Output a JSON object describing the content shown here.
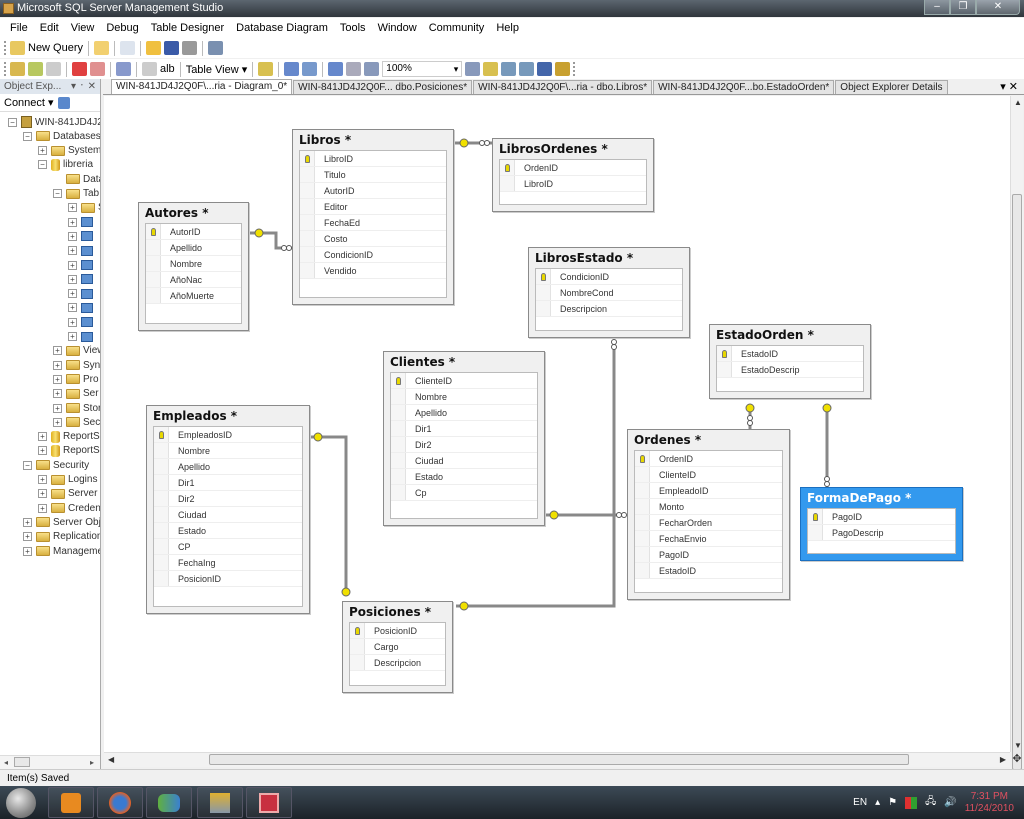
{
  "window": {
    "title": "Microsoft SQL Server Management Studio",
    "minimize": "–",
    "restore": "❐",
    "close": "✕"
  },
  "menu": [
    "File",
    "Edit",
    "View",
    "Debug",
    "Table Designer",
    "Database Diagram",
    "Tools",
    "Window",
    "Community",
    "Help"
  ],
  "toolbar1": {
    "new_query": "New Query"
  },
  "toolbar2": {
    "table_view": "Table View ▾",
    "zoom": "100%",
    "ab_label": "alb"
  },
  "object_explorer": {
    "title": "Object Exp...",
    "pin": "▾ ᛫ ✕",
    "connect": "Connect ▾",
    "nodes": [
      {
        "label": "WIN-841JD4J2",
        "level": 0,
        "expand": "−",
        "icon": "server"
      },
      {
        "label": "Databases",
        "level": 1,
        "expand": "−",
        "icon": "folder"
      },
      {
        "label": "System",
        "level": 2,
        "expand": "+",
        "icon": "folder"
      },
      {
        "label": "libreria",
        "level": 2,
        "expand": "−",
        "icon": "database"
      },
      {
        "label": "Data",
        "level": 3,
        "expand": "",
        "icon": "folder"
      },
      {
        "label": "Tab",
        "level": 3,
        "expand": "−",
        "icon": "folder"
      },
      {
        "label": "S",
        "level": 4,
        "expand": "+",
        "icon": "folder"
      },
      {
        "label": "",
        "level": 4,
        "expand": "+",
        "icon": "table"
      },
      {
        "label": "",
        "level": 4,
        "expand": "+",
        "icon": "table"
      },
      {
        "label": "",
        "level": 4,
        "expand": "+",
        "icon": "table"
      },
      {
        "label": "",
        "level": 4,
        "expand": "+",
        "icon": "table"
      },
      {
        "label": "",
        "level": 4,
        "expand": "+",
        "icon": "table"
      },
      {
        "label": "",
        "level": 4,
        "expand": "+",
        "icon": "table"
      },
      {
        "label": "",
        "level": 4,
        "expand": "+",
        "icon": "table"
      },
      {
        "label": "",
        "level": 4,
        "expand": "+",
        "icon": "table"
      },
      {
        "label": "",
        "level": 4,
        "expand": "+",
        "icon": "table"
      },
      {
        "label": "View",
        "level": 3,
        "expand": "+",
        "icon": "folder"
      },
      {
        "label": "Syn",
        "level": 3,
        "expand": "+",
        "icon": "folder"
      },
      {
        "label": "Pro",
        "level": 3,
        "expand": "+",
        "icon": "folder"
      },
      {
        "label": "Ser",
        "level": 3,
        "expand": "+",
        "icon": "folder"
      },
      {
        "label": "Stor",
        "level": 3,
        "expand": "+",
        "icon": "folder"
      },
      {
        "label": "Sec",
        "level": 3,
        "expand": "+",
        "icon": "folder"
      },
      {
        "label": "ReportS",
        "level": 2,
        "expand": "+",
        "icon": "database"
      },
      {
        "label": "ReportS",
        "level": 2,
        "expand": "+",
        "icon": "database"
      },
      {
        "label": "Security",
        "level": 1,
        "expand": "−",
        "icon": "folder"
      },
      {
        "label": "Logins",
        "level": 2,
        "expand": "+",
        "icon": "folder"
      },
      {
        "label": "Server I",
        "level": 2,
        "expand": "+",
        "icon": "folder"
      },
      {
        "label": "Creden",
        "level": 2,
        "expand": "+",
        "icon": "folder"
      },
      {
        "label": "Server Obj",
        "level": 1,
        "expand": "+",
        "icon": "folder"
      },
      {
        "label": "Replication",
        "level": 1,
        "expand": "+",
        "icon": "folder"
      },
      {
        "label": "Manageme",
        "level": 1,
        "expand": "+",
        "icon": "folder"
      }
    ]
  },
  "tabs": [
    {
      "label": "WIN-841JD4J2Q0F\\...ria - Diagram_0*",
      "active": true
    },
    {
      "label": "WIN-841JD4J2Q0F... dbo.Posiciones*",
      "active": false
    },
    {
      "label": "WIN-841JD4J2Q0F\\...ria - dbo.Libros*",
      "active": false
    },
    {
      "label": "WIN-841JD4J2Q0F...bo.EstadoOrden*",
      "active": false
    },
    {
      "label": "Object Explorer Details",
      "active": false
    }
  ],
  "tab_controls": "▾ ✕",
  "diagram": {
    "tables": [
      {
        "name": "Libros *",
        "columns": [
          "LibroID",
          "Titulo",
          "AutorID",
          "Editor",
          "FechaEd",
          "Costo",
          "CondicionID",
          "Vendido"
        ],
        "pk": [
          0
        ]
      },
      {
        "name": "LibrosOrdenes *",
        "columns": [
          "OrdenID",
          "LibroID"
        ],
        "pk": [
          0
        ]
      },
      {
        "name": "Autores *",
        "columns": [
          "AutorID",
          "Apellido",
          "Nombre",
          "AñoNac",
          "AñoMuerte"
        ],
        "pk": [
          0
        ]
      },
      {
        "name": "LibrosEstado *",
        "columns": [
          "CondicionID",
          "NombreCond",
          "Descripcion"
        ],
        "pk": [
          0
        ]
      },
      {
        "name": "EstadoOrden *",
        "columns": [
          "EstadoID",
          "EstadoDescrip"
        ],
        "pk": [
          0
        ]
      },
      {
        "name": "Clientes *",
        "columns": [
          "ClienteID",
          "Nombre",
          "Apellido",
          "Dir1",
          "Dir2",
          "Ciudad",
          "Estado",
          "Cp"
        ],
        "pk": [
          0
        ]
      },
      {
        "name": "Empleados *",
        "columns": [
          "EmpleadosID",
          "Nombre",
          "Apellido",
          "Dir1",
          "Dir2",
          "Ciudad",
          "Estado",
          "CP",
          "FechaIng",
          "PosicionID"
        ],
        "pk": [
          0
        ]
      },
      {
        "name": "Ordenes *",
        "columns": [
          "OrdenID",
          "ClienteID",
          "EmpleadoID",
          "Monto",
          "FecharOrden",
          "FechaEnvio",
          "PagoID",
          "EstadoID"
        ],
        "pk": [
          0
        ]
      },
      {
        "name": "FormaDePago *",
        "columns": [
          "PagoID",
          "PagoDescrip"
        ],
        "pk": [
          0
        ],
        "selected": true
      },
      {
        "name": "Posiciones *",
        "columns": [
          "PosicionID",
          "Cargo",
          "Descripcion"
        ],
        "pk": [
          0
        ]
      }
    ]
  },
  "status": "Item(s) Saved",
  "taskbar": {
    "lang": "EN",
    "time": "7:31 PM",
    "date": "11/24/2010"
  }
}
